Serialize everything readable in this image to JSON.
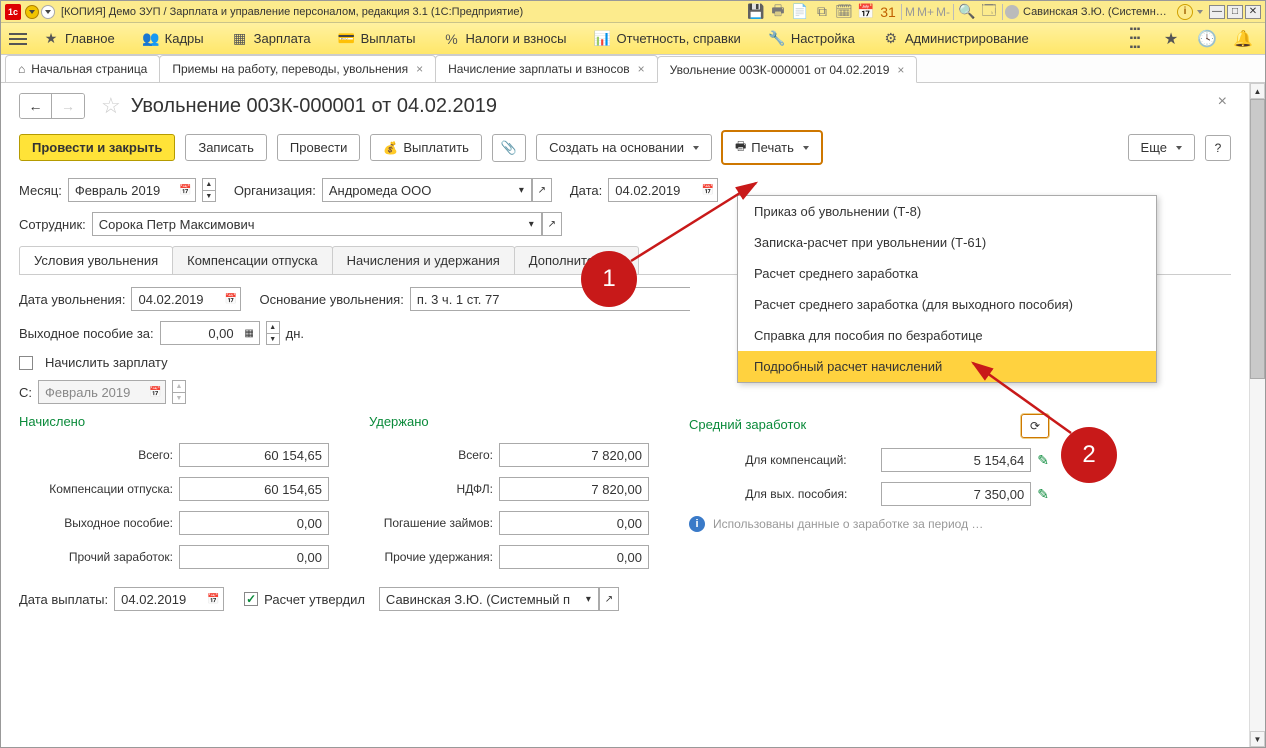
{
  "title_bar": {
    "title": "[КОПИЯ] Демо ЗУП / Зарплата и управление персоналом, редакция 3.1  (1С:Предприятие)",
    "m_buttons": [
      "M",
      "M+",
      "M-"
    ],
    "user": "Савинская З.Ю. (Системный прог…"
  },
  "main_nav": {
    "items": [
      "Главное",
      "Кадры",
      "Зарплата",
      "Выплаты",
      "Налоги и взносы",
      "Отчетность, справки",
      "Настройка",
      "Администрирование"
    ]
  },
  "tabs": {
    "home": "Начальная страница",
    "items": [
      "Приемы на работу, переводы, увольнения",
      "Начисление зарплаты и взносов",
      "Увольнение 00ЗК-000001 от 04.02.2019"
    ]
  },
  "page": {
    "title": "Увольнение 00ЗК-000001 от 04.02.2019",
    "toolbar": {
      "post_close": "Провести и закрыть",
      "save": "Записать",
      "post": "Провести",
      "pay": "Выплатить",
      "create_based": "Создать на основании",
      "print": "Печать",
      "more": "Еще"
    },
    "filters": {
      "month_label": "Месяц:",
      "month_value": "Февраль 2019",
      "org_label": "Организация:",
      "org_value": "Андромеда ООО",
      "date_label": "Дата:",
      "date_value": "04.02.2019",
      "employee_label": "Сотрудник:",
      "employee_value": "Сорока Петр Максимович"
    },
    "inner_tabs": [
      "Условия увольнения",
      "Компенсации отпуска",
      "Начисления и удержания",
      "Дополнитель"
    ],
    "conditions": {
      "dismiss_date_label": "Дата увольнения:",
      "dismiss_date_value": "04.02.2019",
      "basis_label": "Основание увольнения:",
      "basis_value": "п. 3 ч. 1 ст. 77",
      "severance_label": "Выходное пособие за:",
      "severance_value": "0,00",
      "severance_unit": "дн.",
      "accrue_salary_label": "Начислить зарплату",
      "from_label": "С:",
      "from_value": "Февраль 2019"
    },
    "cols": {
      "accrued": {
        "header": "Начислено",
        "total_label": "Всего:",
        "total": "60 154,65",
        "comp_label": "Компенсации отпуска:",
        "comp": "60 154,65",
        "sev_label": "Выходное пособие:",
        "sev": "0,00",
        "other_label": "Прочий заработок:",
        "other": "0,00"
      },
      "withheld": {
        "header": "Удержано",
        "total_label": "Всего:",
        "total": "7 820,00",
        "ndfl_label": "НДФЛ:",
        "ndfl": "7 820,00",
        "loan_label": "Погашение займов:",
        "loan": "0,00",
        "other_label": "Прочие удержания:",
        "other": "0,00"
      },
      "average": {
        "header": "Средний заработок",
        "comp_label": "Для компенсаций:",
        "comp": "5 154,64",
        "sev_label": "Для вых. пособия:",
        "sev": "7 350,00",
        "info_text": "Использованы данные о заработке за период …"
      }
    },
    "footer": {
      "pay_date_label": "Дата выплаты:",
      "pay_date_value": "04.02.2019",
      "approved_label": "Расчет утвердил",
      "approved_by": "Савинская З.Ю. (Системный п"
    }
  },
  "print_menu": {
    "items": [
      "Приказ об увольнении (Т-8)",
      "Записка-расчет при увольнении (Т-61)",
      "Расчет среднего заработка",
      "Расчет среднего заработка (для выходного пособия)",
      "Справка для пособия по безработице",
      "Подробный расчет начислений"
    ],
    "highlighted_index": 5
  },
  "annotations": {
    "one": "1",
    "two": "2"
  }
}
